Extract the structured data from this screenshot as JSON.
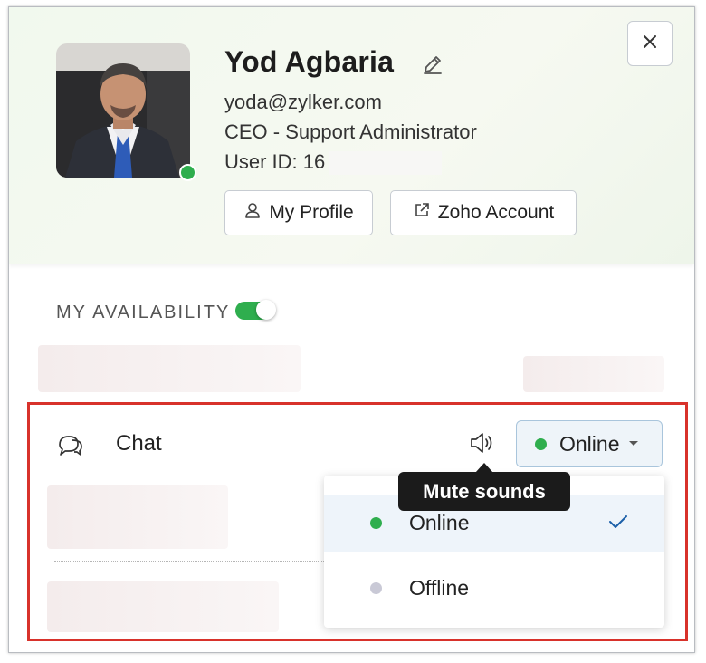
{
  "profile": {
    "name": "Yod Agbaria",
    "email": "yoda@zylker.com",
    "role": "CEO - Support Administrator",
    "user_id": "User ID: 16",
    "status_color": "#2fae4e"
  },
  "buttons": {
    "my_profile": "My Profile",
    "zoho_account": "Zoho Account",
    "close": "×"
  },
  "availability": {
    "label": "MY AVAILABILITY",
    "enabled": true
  },
  "chat": {
    "label": "Chat",
    "status": "Online",
    "tooltip": "Mute sounds",
    "options": [
      {
        "label": "Online",
        "color": "#2fae4e",
        "selected": true
      },
      {
        "label": "Offline",
        "color": "#c9c9d6",
        "selected": false
      }
    ]
  },
  "colors": {
    "highlight_border": "#d8322b",
    "accent": "#1b5fa8"
  }
}
